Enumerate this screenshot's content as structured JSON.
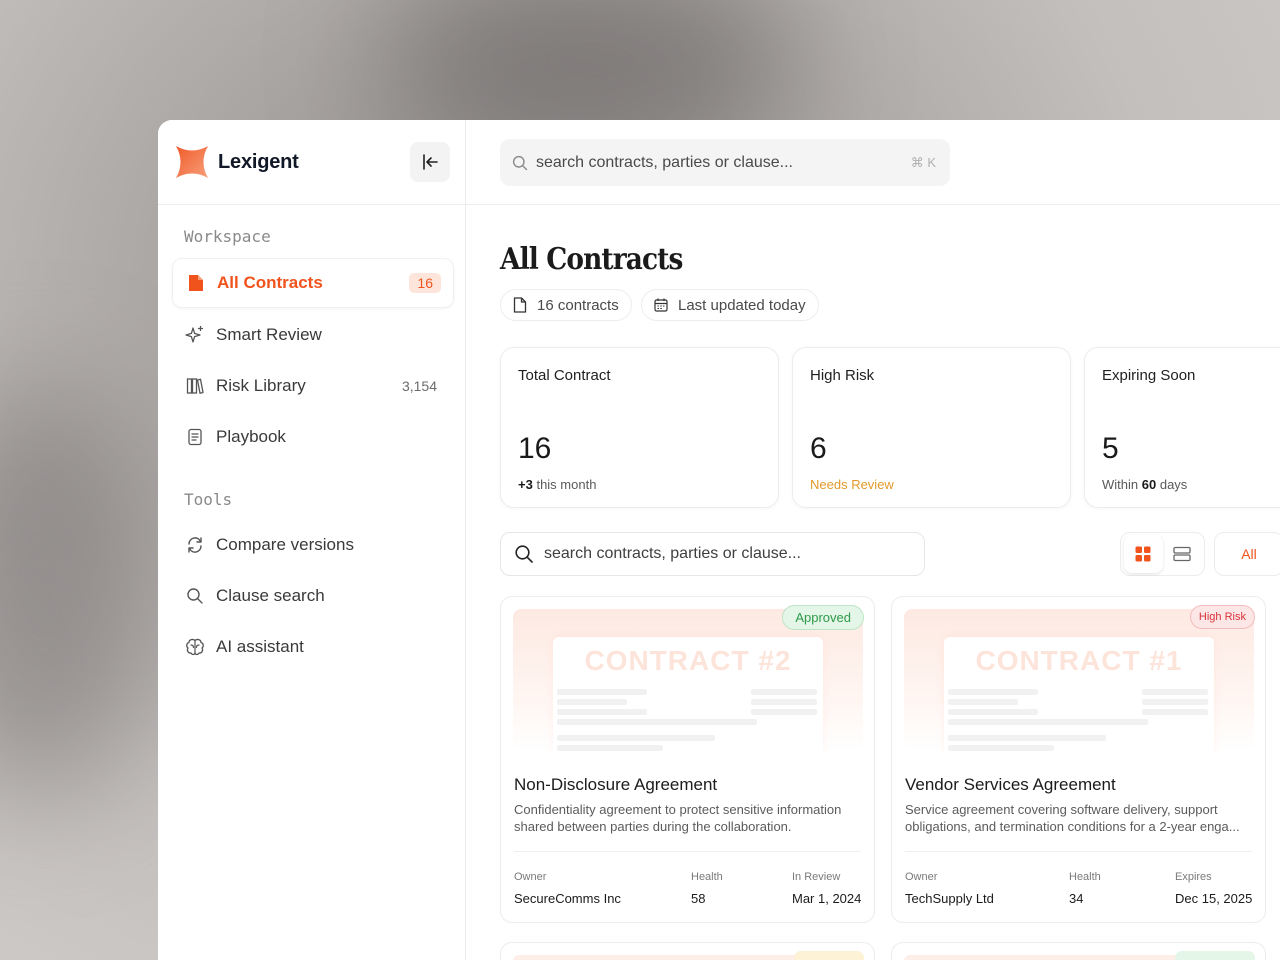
{
  "brand": {
    "name": "Lexigent"
  },
  "search_top": {
    "placeholder": "search contracts, parties or clause...",
    "shortcut": "⌘ K"
  },
  "sidebar": {
    "workspace_label": "Workspace",
    "tools_label": "Tools",
    "workspace_items": [
      {
        "label": "All Contracts",
        "badge": "16",
        "icon": "document-icon",
        "active": true
      },
      {
        "label": "Smart Review",
        "icon": "sparkle-icon"
      },
      {
        "label": "Risk Library",
        "count": "3,154",
        "icon": "books-icon"
      },
      {
        "label": "Playbook",
        "icon": "notebook-icon"
      }
    ],
    "tool_items": [
      {
        "label": "Compare versions",
        "icon": "refresh-icon"
      },
      {
        "label": "Clause search",
        "icon": "search-icon"
      },
      {
        "label": "AI assistant",
        "icon": "brain-icon"
      }
    ]
  },
  "page": {
    "title": "All Contracts",
    "chips": [
      {
        "label": "16 contracts",
        "icon": "file-icon"
      },
      {
        "label": "Last updated today",
        "icon": "calendar-icon"
      }
    ]
  },
  "stats": [
    {
      "title": "Total Contract",
      "value": "16",
      "sub_bold": "+3",
      "sub": "this month"
    },
    {
      "title": "High Risk",
      "value": "6",
      "sub": "Needs Review"
    },
    {
      "title": "Expiring Soon",
      "value": "5",
      "sub_pre": "Within",
      "sub_bold": "60",
      "sub": "days"
    }
  ],
  "filter": {
    "placeholder": "search contracts, parties or clause...",
    "all_label": "All"
  },
  "contracts": [
    {
      "watermark": "CONTRACT #2",
      "status": "Approved",
      "name": "Non-Disclosure Agreement",
      "desc_1": "Confidentiality agreement to protect sensitive information",
      "desc_2": "shared between parties during the collaboration.",
      "owner_label": "Owner",
      "owner": "SecureComms Inc",
      "health_label": "Health",
      "health": "58",
      "date_label": "In Review",
      "date": "Mar 1, 2024"
    },
    {
      "watermark": "CONTRACT #1",
      "status": "High Risk",
      "name": "Vendor Services Agreement",
      "desc_1": "Service agreement covering software delivery, support",
      "desc_2": "obligations, and termination conditions for a 2-year enga...",
      "owner_label": "Owner",
      "owner": "TechSupply Ltd",
      "health_label": "Health",
      "health": "34",
      "date_label": "Expires",
      "date": "Dec 15, 2025"
    }
  ],
  "colors": {
    "accent": "#f0531c",
    "approved": "#2e9a4a",
    "risk": "#d8323a",
    "warn": "#e39a2a"
  }
}
